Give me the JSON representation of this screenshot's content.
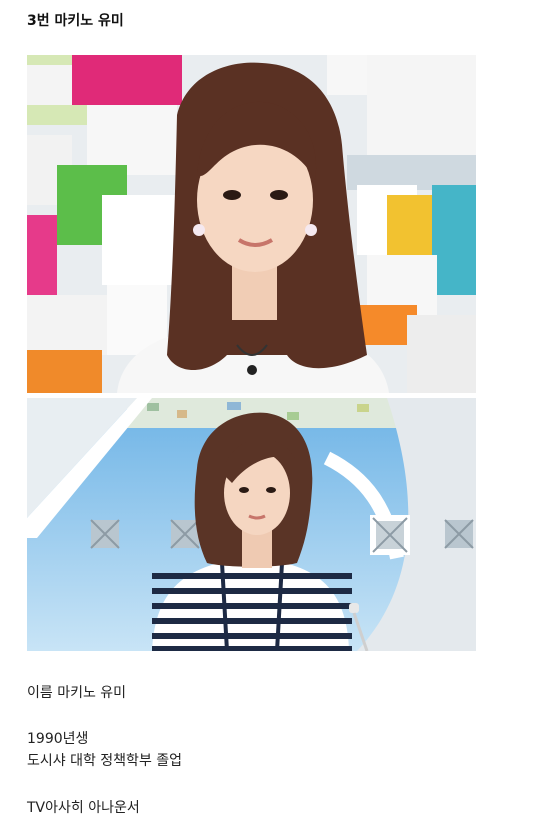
{
  "post": {
    "title": "3번 마키노 유미"
  },
  "images": [
    {
      "subject": "announcer-portrait-studio-set"
    },
    {
      "subject": "announcer-striped-top-news-set"
    }
  ],
  "profile": {
    "name_line": "이름 마키노 유미",
    "birth_line": "1990년생",
    "education_line": "도시샤 대학 정책학부 졸업",
    "job_line": "TV아사히 아나운서"
  }
}
